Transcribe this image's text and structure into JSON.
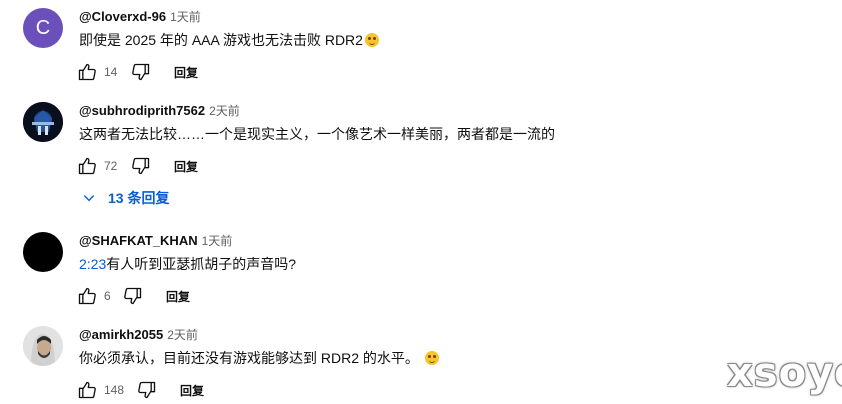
{
  "comments": [
    {
      "avatar_letter": "C",
      "avatar_color": "#6b4fbb",
      "author": "@Cloverxd-96",
      "time": "1天前",
      "text": "即使是 2025 年的 AAA 游戏也无法击败 RDR2",
      "emoji": "grinning-face-icon",
      "likes": "14",
      "reply_label": "回复"
    },
    {
      "author": "@subhrodiprith7562",
      "time": "2天前",
      "text": "这两者无法比较……一个是现实主义，一个像艺术一样美丽，两者都是一流的",
      "likes": "72",
      "reply_label": "回复",
      "replies_label": "13 条回复"
    },
    {
      "author": "@SHAFKAT_KHAN",
      "time": "1天前",
      "timestamp_link": "2:23",
      "text": "有人听到亚瑟抓胡子的声音吗?",
      "likes": "6",
      "reply_label": "回复"
    },
    {
      "author": "@amirkh2055",
      "time": "2天前",
      "text": "你必须承认，目前还没有游戏能够达到 RDR2 的水平。",
      "emoji": "smiling-face-icon",
      "likes": "148",
      "reply_label": "回复"
    }
  ],
  "watermark": "xsoyo",
  "colors": {
    "link": "#065fd4",
    "secondary_text": "#606060",
    "primary_text": "#0f0f0f"
  }
}
